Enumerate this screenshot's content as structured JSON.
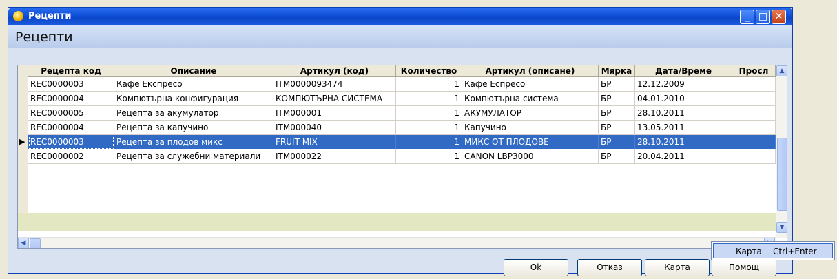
{
  "window": {
    "title": "Рецепти",
    "heading": "Рецепти",
    "controls": {
      "minimize": "_",
      "maximize": "□",
      "close": "✕"
    }
  },
  "table": {
    "columns": [
      "Рецепта код",
      "Описание",
      "Артикул (код)",
      "Количество",
      "Артикул (описане)",
      "Мярка",
      "Дата/Време",
      "Просл"
    ],
    "rows": [
      [
        "REC0000003",
        "Кафе Експресо",
        "ITM0000093474",
        "1",
        "Кафе Еспресо",
        "БР",
        "12.12.2009",
        ""
      ],
      [
        "REC0000004",
        "Компютърна конфигурация",
        "КОМПЮТЪРНА СИСТЕМА",
        "1",
        "Компютърна система",
        "БР",
        "04.01.2010",
        ""
      ],
      [
        "REC0000005",
        "Рецепта за акумулатор",
        "ITM000001",
        "1",
        "АКУМУЛАТОР",
        "БР",
        "28.10.2011",
        ""
      ],
      [
        "REC0000004",
        "Рецепта за капучино",
        "ITM000040",
        "1",
        "Капучино",
        "БР",
        "13.05.2011",
        ""
      ],
      [
        "REC0000003",
        "Рецепта за плодов микс",
        "FRUIT MIX",
        "1",
        "МИКС ОТ ПЛОДОВЕ",
        "БР",
        "28.10.2011",
        ""
      ],
      [
        "REC0000002",
        "Рецепта за служебни материали",
        "ITM000022",
        "1",
        "CANON LBP3000",
        "БР",
        "20.04.2011",
        ""
      ]
    ],
    "selected_row": 5,
    "current_row_marker": "▶"
  },
  "buttons": {
    "ok": "Ok",
    "cancel": "Отказ",
    "card": "Карта",
    "help": "Помощ"
  },
  "popup_menu": {
    "item_label": "Карта",
    "item_shortcut": "Ctrl+Enter"
  },
  "colors": {
    "selection": "#316ac5",
    "titlebar": "#0a46c8"
  }
}
